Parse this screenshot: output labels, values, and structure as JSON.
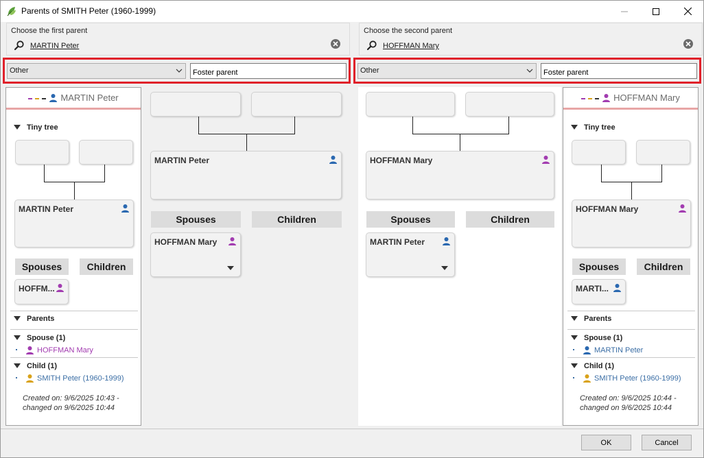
{
  "window": {
    "title": "Parents of SMITH Peter (1960-1999)"
  },
  "first_parent": {
    "chooser_label": "Choose the first parent",
    "name": "MARTIN Peter",
    "relation_type": "Other",
    "relation_label": "Foster parent",
    "gender_color": "#2a68b0",
    "side": {
      "header": "MARTIN Peter",
      "tiny_tree_label": "Tiny tree",
      "tree": {
        "person": "MARTIN Peter",
        "spouses_label": "Spouses",
        "children_label": "Children",
        "spouse_abbrev": "HOFFM..."
      },
      "parents_label": "Parents",
      "spouse_section": "Spouse (1)",
      "spouse_name": "HOFFMAN Mary",
      "child_section": "Child (1)",
      "child_name": "SMITH Peter (1960-1999)",
      "meta": "Created on: 9/6/2025 10:43 - changed on 9/6/2025 10:44"
    },
    "center": {
      "person": "MARTIN Peter",
      "spouses_label": "Spouses",
      "children_label": "Children",
      "spouse": "HOFFMAN Mary"
    }
  },
  "second_parent": {
    "chooser_label": "Choose the second parent",
    "name": "HOFFMAN Mary",
    "relation_type": "Other",
    "relation_label": "Foster parent",
    "gender_color": "#a23cb0",
    "side": {
      "header": "HOFFMAN Mary",
      "tiny_tree_label": "Tiny tree",
      "tree": {
        "person": "HOFFMAN Mary",
        "spouses_label": "Spouses",
        "children_label": "Children",
        "spouse_abbrev": "MARTI..."
      },
      "parents_label": "Parents",
      "spouse_section": "Spouse (1)",
      "spouse_name": "MARTIN Peter",
      "child_section": "Child (1)",
      "child_name": "SMITH Peter (1960-1999)",
      "meta": "Created on: 9/6/2025 10:44 - changed on 9/6/2025 10:44"
    },
    "center": {
      "person": "HOFFMAN Mary",
      "spouses_label": "Spouses",
      "children_label": "Children",
      "spouse": "MARTIN Peter"
    }
  },
  "footer": {
    "ok_label": "OK",
    "cancel_label": "Cancel"
  },
  "colors": {
    "male": "#2a68b0",
    "female": "#a23cb0",
    "child": "#d9a21a",
    "highlight": "#e0202a",
    "header_rule": "#e8a6a6",
    "link": "#3b6ea5"
  },
  "icons": {
    "app": "tree-leaf-icon",
    "search": "search-icon",
    "clear": "clear-circle-icon",
    "person": "person-icon",
    "dropdown": "chevron-down-icon"
  }
}
